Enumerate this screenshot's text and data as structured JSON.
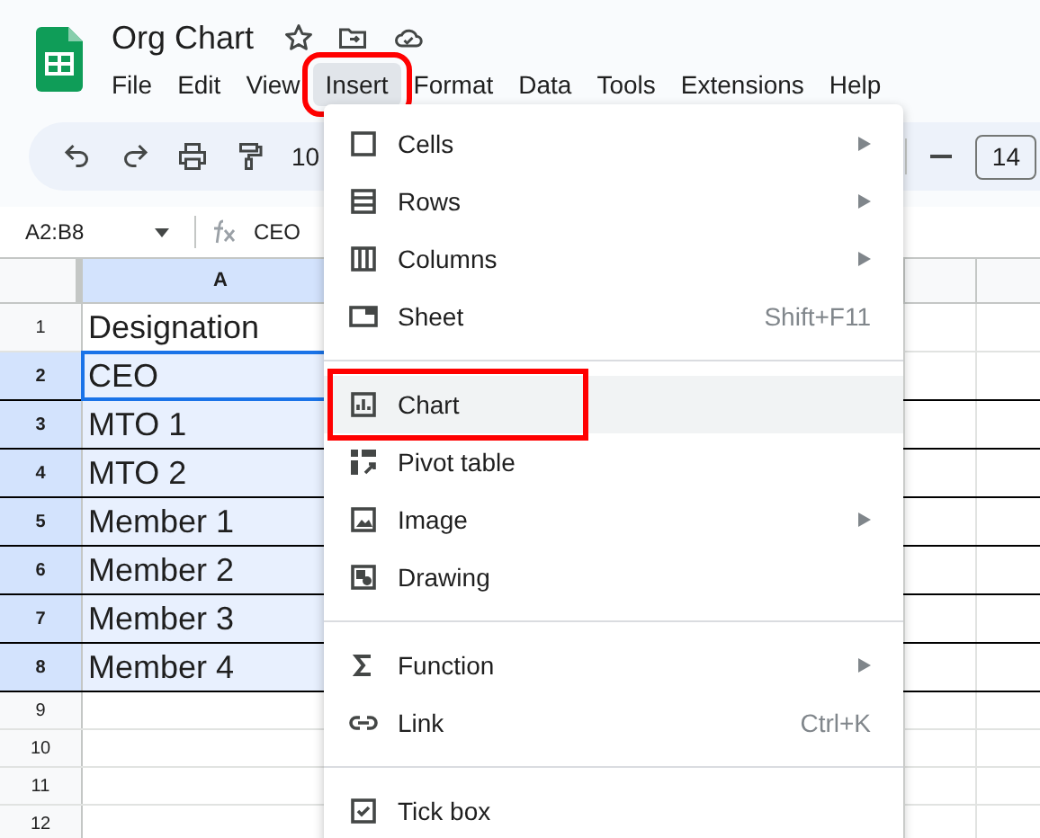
{
  "document": {
    "title": "Org Chart"
  },
  "menu_bar": [
    {
      "label": "File",
      "selected": false,
      "highlighted": false
    },
    {
      "label": "Edit",
      "selected": false,
      "highlighted": false
    },
    {
      "label": "View",
      "selected": false,
      "highlighted": false
    },
    {
      "label": "Insert",
      "selected": true,
      "highlighted": true
    },
    {
      "label": "Format",
      "selected": false,
      "highlighted": false
    },
    {
      "label": "Data",
      "selected": false,
      "highlighted": false
    },
    {
      "label": "Tools",
      "selected": false,
      "highlighted": false
    },
    {
      "label": "Extensions",
      "selected": false,
      "highlighted": false
    },
    {
      "label": "Help",
      "selected": false,
      "highlighted": false
    }
  ],
  "toolbar": {
    "zoom": "10",
    "font_size": "14"
  },
  "formula_bar": {
    "name_box": "A2:B8",
    "content": "CEO"
  },
  "sheet": {
    "columns": [
      {
        "label": "A",
        "selected": true
      }
    ],
    "rows": [
      {
        "number": "1",
        "selected": false,
        "cell": "Designation",
        "active": false
      },
      {
        "number": "2",
        "selected": true,
        "cell": "CEO",
        "active": true
      },
      {
        "number": "3",
        "selected": true,
        "cell": "MTO 1",
        "active": false
      },
      {
        "number": "4",
        "selected": true,
        "cell": "MTO 2",
        "active": false
      },
      {
        "number": "5",
        "selected": true,
        "cell": "Member 1",
        "active": false
      },
      {
        "number": "6",
        "selected": true,
        "cell": "Member 2",
        "active": false
      },
      {
        "number": "7",
        "selected": true,
        "cell": "Member 3",
        "active": false
      },
      {
        "number": "8",
        "selected": true,
        "cell": "Member 4",
        "active": false
      },
      {
        "number": "9",
        "selected": false
      },
      {
        "number": "10",
        "selected": false
      },
      {
        "number": "11",
        "selected": false
      },
      {
        "number": "12",
        "selected": false
      }
    ]
  },
  "insert_menu": {
    "items": [
      {
        "kind": "item",
        "label": "Cells",
        "submenu": true,
        "selected": false,
        "highlighted": false
      },
      {
        "kind": "item",
        "label": "Rows",
        "submenu": true,
        "selected": false,
        "highlighted": false
      },
      {
        "kind": "item",
        "label": "Columns",
        "submenu": true,
        "selected": false,
        "highlighted": false
      },
      {
        "kind": "item",
        "label": "Sheet",
        "shortcut": "Shift+F11",
        "submenu": false,
        "selected": false,
        "highlighted": false
      },
      {
        "kind": "divider"
      },
      {
        "kind": "item",
        "label": "Chart",
        "submenu": false,
        "selected": true,
        "highlighted": true
      },
      {
        "kind": "item",
        "label": "Pivot table",
        "submenu": false,
        "selected": false,
        "highlighted": false
      },
      {
        "kind": "item",
        "label": "Image",
        "submenu": true,
        "selected": false,
        "highlighted": false
      },
      {
        "kind": "item",
        "label": "Drawing",
        "submenu": false,
        "selected": false,
        "highlighted": false
      },
      {
        "kind": "divider"
      },
      {
        "kind": "item",
        "label": "Function",
        "submenu": true,
        "selected": false,
        "highlighted": false
      },
      {
        "kind": "item",
        "label": "Link",
        "shortcut": "Ctrl+K",
        "submenu": false,
        "selected": false,
        "highlighted": false
      },
      {
        "kind": "divider"
      },
      {
        "kind": "item",
        "label": "Tick box",
        "submenu": false,
        "selected": false,
        "highlighted": false
      }
    ]
  }
}
